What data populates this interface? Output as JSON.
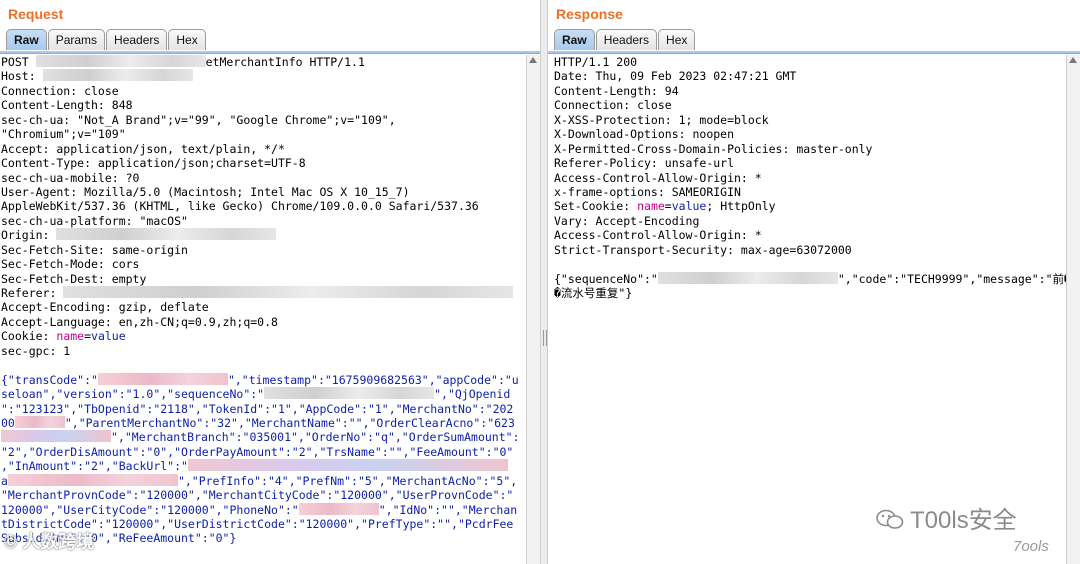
{
  "request": {
    "title": "Request",
    "tabs": [
      "Raw",
      "Params",
      "Headers",
      "Hex"
    ],
    "active_tab": "Raw",
    "lines": [
      [
        "POST ",
        {
          "redact": 170
        },
        "etMerchantInfo HTTP/1.1"
      ],
      [
        "Host: ",
        {
          "redact": 150
        }
      ],
      [
        "Connection: close"
      ],
      [
        "Content-Length: 848"
      ],
      [
        "sec-ch-ua: \"Not_A Brand\";v=\"99\", \"Google Chrome\";v=\"109\","
      ],
      [
        "\"Chromium\";v=\"109\""
      ],
      [
        "Accept: application/json, text/plain, */*"
      ],
      [
        "Content-Type: application/json;charset=UTF-8"
      ],
      [
        "sec-ch-ua-mobile: ?0"
      ],
      [
        "User-Agent: Mozilla/5.0 (Macintosh; Intel Mac OS X 10_15_7)"
      ],
      [
        "AppleWebKit/537.36 (KHTML, like Gecko) Chrome/109.0.0.0 Safari/537.36"
      ],
      [
        "sec-ch-ua-platform: \"macOS\""
      ],
      [
        "Origin: ",
        {
          "redact": 220
        }
      ],
      [
        "Sec-Fetch-Site: same-origin"
      ],
      [
        "Sec-Fetch-Mode: cors"
      ],
      [
        "Sec-Fetch-Dest: empty"
      ],
      [
        "Referer: ",
        {
          "redact": 450
        }
      ],
      [
        "Accept-Encoding: gzip, deflate"
      ],
      [
        "Accept-Language: en,zh-CN;q=0.9,zh;q=0.8"
      ],
      [
        "Cookie: ",
        {
          "kw": "name"
        },
        "=",
        {
          "bl": "value"
        }
      ],
      [
        "sec-gpc: 1"
      ],
      [
        ""
      ],
      [
        {
          "bl": "{\"transCode\":\""
        },
        {
          "redact": 130,
          "style": "pink"
        },
        {
          "bl": "\",\"timestamp\":\"1675909682563\",\"appCode\":\"u"
        }
      ],
      [
        {
          "bl": "seloan\",\"version\":\"1.0\",\"sequenceNo\":\""
        },
        {
          "redact": 170
        },
        {
          "bl": "\",\"QjOpenid"
        }
      ],
      [
        {
          "bl": "\":\"123123\",\"TbOpenid\":\"2118\",\"TokenId\":\"1\",\"AppCode\":\"1\",\"MerchantNo\":\"202"
        }
      ],
      [
        {
          "bl": "00"
        },
        {
          "redact": 50,
          "style": "pink"
        },
        {
          "bl": "\",\"ParentMerchantNo\":\"32\",\"MerchantName\":\"\",\"OrderClearAcno\":\"623"
        }
      ],
      [
        {
          "redact": 110,
          "style": "mix"
        },
        {
          "bl": "\",\"MerchantBranch\":\"035001\",\"OrderNo\":\"q\",\"OrderSumAmount\":"
        }
      ],
      [
        {
          "bl": "\"2\",\"OrderDisAmount\":\"0\",\"OrderPayAmount\":\"2\",\"TrsName\":\"\",\"FeeAmount\":\"0\""
        }
      ],
      [
        {
          "bl": ",\"InAmount\":\"2\",\"BackUrl\":\""
        },
        {
          "redact": 320,
          "style": "mix"
        }
      ],
      [
        {
          "bl": "a"
        },
        {
          "redact": 170,
          "style": "pink"
        },
        {
          "bl": "\",\"PrefInfo\":\"4\",\"PrefNm\":\"5\",\"MerchantAcNo\":\"5\","
        }
      ],
      [
        {
          "bl": "\"MerchantProvnCode\":\"120000\",\"MerchantCityCode\":\"120000\",\"UserProvnCode\":\""
        }
      ],
      [
        {
          "bl": "120000\",\"UserCityCode\":\"120000\",\"PhoneNo\":\""
        },
        {
          "redact": 80,
          "style": "pink"
        },
        {
          "bl": "\",\"IdNo\":\"\",\"Merchan"
        }
      ],
      [
        {
          "bl": "tDistrictCode\":\"120000\",\"UserDistrictCode\":\"120000\",\"PrefType\":\"\",\"PcdrFee"
        }
      ],
      [
        {
          "bl": "SubsidyAmt\":\"0\",\"ReFeeAmount\":\"0\"}"
        }
      ]
    ]
  },
  "response": {
    "title": "Response",
    "tabs": [
      "Raw",
      "Headers",
      "Hex"
    ],
    "active_tab": "Raw",
    "lines": [
      [
        "HTTP/1.1 200"
      ],
      [
        "Date: Thu, 09 Feb 2023 02:47:21 GMT"
      ],
      [
        "Content-Length: 94"
      ],
      [
        "Connection: close"
      ],
      [
        "X-XSS-Protection: 1; mode=block"
      ],
      [
        "X-Download-Options: noopen"
      ],
      [
        "X-Permitted-Cross-Domain-Policies: master-only"
      ],
      [
        "Referer-Policy: unsafe-url"
      ],
      [
        "Access-Control-Allow-Origin: *"
      ],
      [
        "x-frame-options: SAMEORIGIN"
      ],
      [
        "Set-Cookie: ",
        {
          "kw": "name"
        },
        "=",
        {
          "bl": "value"
        },
        "; HttpOnly"
      ],
      [
        "Vary: Accept-Encoding"
      ],
      [
        "Access-Control-Allow-Origin: *"
      ],
      [
        "Strict-Transport-Security: max-age=63072000"
      ],
      [
        ""
      ],
      [
        "{\"sequenceNo\":\"",
        {
          "redact": 180
        },
        "\",\"code\":\"TECH9999\",\"message\":\"前�"
      ],
      [
        "�流水号重复\"}"
      ]
    ]
  },
  "watermarks": {
    "left": "© 人数跨境",
    "right": "T00ls安全",
    "right_small": "7ools"
  }
}
